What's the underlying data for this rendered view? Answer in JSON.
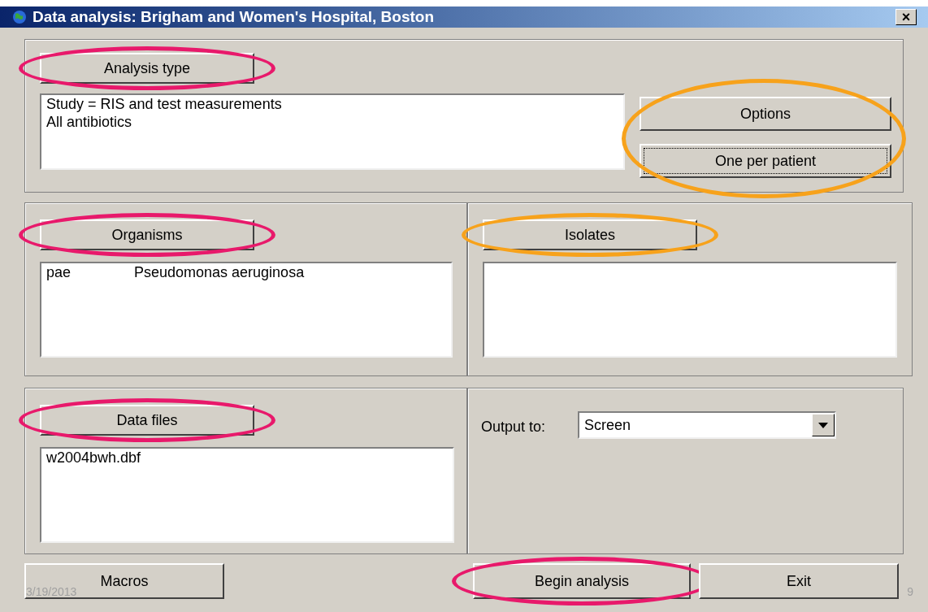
{
  "window": {
    "title": "Data analysis:  Brigham and Women's Hospital, Boston",
    "close": "×"
  },
  "analysis": {
    "button": {
      "label": "Analysis type",
      "color": "#e8196b"
    },
    "lines": [
      "Study = RIS and test measurements",
      "All antibiotics"
    ],
    "side_buttons": {
      "color": "#f7a21b",
      "items": [
        {
          "label": "Options",
          "focused": false
        },
        {
          "label": "One per patient",
          "focused": true
        }
      ]
    }
  },
  "organisms": {
    "button": {
      "label": "Organisms",
      "color": "#e8196b"
    },
    "rows": [
      {
        "code": "pae",
        "name": "Pseudomonas aeruginosa"
      }
    ]
  },
  "isolates": {
    "button": {
      "label": "Isolates",
      "color": "#f7a21b"
    }
  },
  "data_files": {
    "button": {
      "label": "Data files",
      "color": "#e8196b"
    },
    "rows": [
      "w2004bwh.dbf"
    ]
  },
  "output": {
    "label": "Output to:",
    "value": "Screen"
  },
  "footer_buttons": [
    {
      "label": "Macros"
    },
    {
      "label": "Begin analysis",
      "color": "#e8196b"
    },
    {
      "label": "Exit"
    }
  ],
  "slide_footer": {
    "date": "3/19/2013",
    "page": "9"
  }
}
